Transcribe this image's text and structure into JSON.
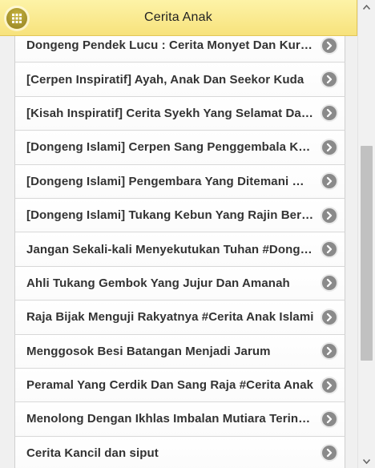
{
  "header": {
    "title": "Cerita Anak",
    "menu_icon": "grid-menu-icon",
    "background": "#f9e88a",
    "accent": "#a8942e"
  },
  "list": {
    "arrow_icon": "chevron-right-circle-icon",
    "items": [
      {
        "label": "Dongeng Pendek Lucu : Cerita Monyet Dan Kura-Kura"
      },
      {
        "label": "[Cerpen Inspiratif] Ayah, Anak Dan Seekor Kuda"
      },
      {
        "label": "[Kisah Inspiratif] Cerita Syekh Yang Selamat Dari Maut"
      },
      {
        "label": "[Dongeng Islami] Cerpen Sang Penggembala Kambing"
      },
      {
        "label": "[Dongeng Islami] Pengembara Yang Ditemani Malaikat"
      },
      {
        "label": "[Dongeng Islami] Tukang Kebun Yang Rajin Bersedekah"
      },
      {
        "label": "Jangan Sekali-kali Menyekutukan Tuhan #Dongeng Islami"
      },
      {
        "label": "Ahli Tukang Gembok Yang Jujur Dan Amanah"
      },
      {
        "label": "Raja Bijak Menguji Rakyatnya #Cerita Anak Islami"
      },
      {
        "label": "Menggosok Besi Batangan Menjadi Jarum"
      },
      {
        "label": "Peramal Yang Cerdik Dan Sang Raja #Cerita Anak"
      },
      {
        "label": "Menolong Dengan Ikhlas Imbalan Mutiara Terindah"
      },
      {
        "label": "Cerita Kancil dan siput"
      }
    ]
  },
  "scrollbar": {
    "up_icon": "scroll-up-arrow-icon",
    "down_icon": "scroll-down-arrow-icon"
  }
}
